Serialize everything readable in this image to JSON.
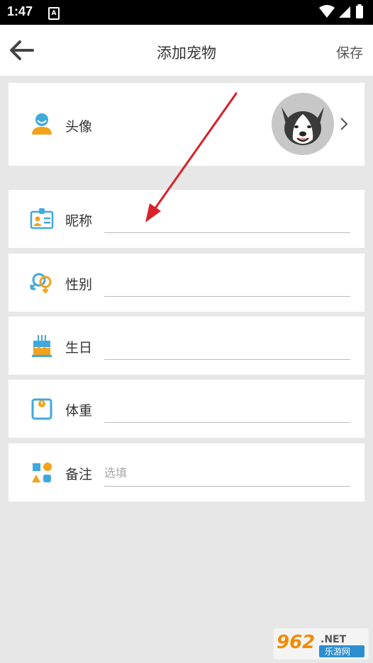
{
  "status_bar": {
    "time": "1:47",
    "notification_letter": "A",
    "icons": [
      "wifi-icon",
      "signal-icon",
      "battery-icon"
    ]
  },
  "app_bar": {
    "back_icon": "back-arrow-icon",
    "title": "添加宠物",
    "save_label": "保存"
  },
  "avatar_row": {
    "label": "头像",
    "icon": "person-icon",
    "avatar_image": "husky-dog-avatar",
    "chevron": "chevron-right-icon"
  },
  "fields": [
    {
      "key": "nickname",
      "label": "昵称",
      "icon": "id-card-icon",
      "value": "",
      "placeholder": ""
    },
    {
      "key": "gender",
      "label": "性别",
      "icon": "gender-icon",
      "value": "",
      "placeholder": ""
    },
    {
      "key": "birthday",
      "label": "生日",
      "icon": "birthday-cake-icon",
      "value": "",
      "placeholder": ""
    },
    {
      "key": "weight",
      "label": "体重",
      "icon": "scale-icon",
      "value": "",
      "placeholder": ""
    },
    {
      "key": "notes",
      "label": "备注",
      "icon": "shapes-icon",
      "value": "",
      "placeholder": "选填"
    }
  ],
  "annotation": {
    "arrow_color": "#d9212a"
  },
  "watermark": {
    "number": "962",
    "suffix": ".NET",
    "text": "乐游网"
  },
  "colors": {
    "accent_blue": "#3fa9dd",
    "accent_orange": "#f2a21b",
    "background": "#e7e7e7",
    "card": "#ffffff"
  }
}
